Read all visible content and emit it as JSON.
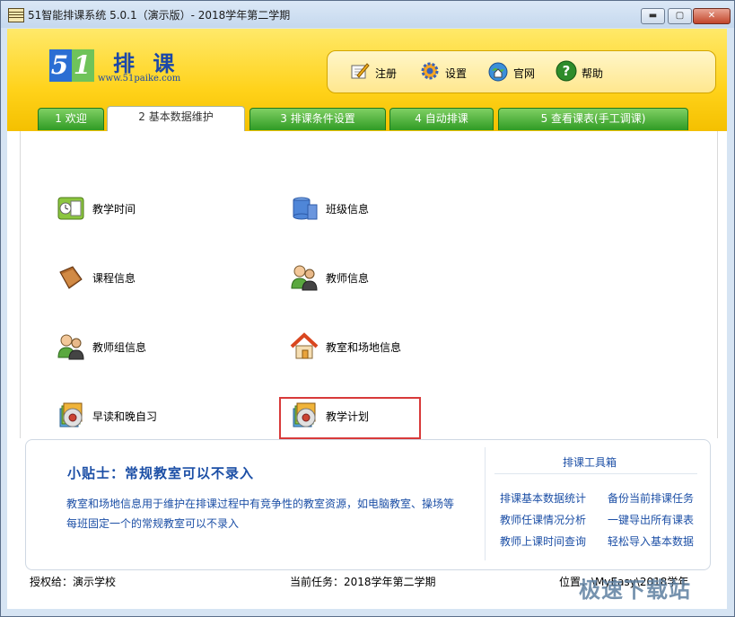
{
  "window": {
    "title": "51智能排课系统 5.0.1（演示版）- 2018学年第二学期",
    "minimize": "▬",
    "maximize": "▢",
    "close": "✕"
  },
  "logo": {
    "digit5": "5",
    "digit1": "1",
    "text": "排 课",
    "url": "www.51paike.com"
  },
  "toolbar": {
    "register": "注册",
    "settings": "设置",
    "website": "官网",
    "help": "帮助"
  },
  "tabs": [
    {
      "label": "1 欢迎"
    },
    {
      "label": "2 基本数据维护"
    },
    {
      "label": "3 排课条件设置"
    },
    {
      "label": "4 自动排课"
    },
    {
      "label": "5 查看课表(手工调课)"
    }
  ],
  "items": {
    "teaching_time": "教学时间",
    "class_info": "班级信息",
    "course_info": "课程信息",
    "teacher_info": "教师信息",
    "teacher_group": "教师组信息",
    "classroom_venue": "教室和场地信息",
    "morning_evening": "早读和晚自习",
    "teaching_plan": "教学计划"
  },
  "tips": {
    "title": "小贴士：常规教室可以不录入",
    "line1": "教室和场地信息用于维护在排课过程中有竞争性的教室资源，如电脑教室、操场等",
    "line2": "每班固定一个的常规教室可以不录入"
  },
  "tools": {
    "title": "排课工具箱",
    "stats": "排课基本数据统计",
    "backup": "备份当前排课任务",
    "teacher_load": "教师任课情况分析",
    "export_all": "一键导出所有课表",
    "teacher_time": "教师上课时间查询",
    "import_basic": "轻松导入基本数据"
  },
  "status": {
    "licensed_to": "授权给：演示学校",
    "current_task": "当前任务：2018学年第二学期",
    "location": "位置：\\MyEasy\\2018学年"
  },
  "watermark": "极速下载站",
  "colors": {
    "header_yellow": "#ffd21a",
    "tab_green": "#2f9b24",
    "link_blue": "#1c4fa6",
    "highlight_red": "#d83a3a"
  }
}
